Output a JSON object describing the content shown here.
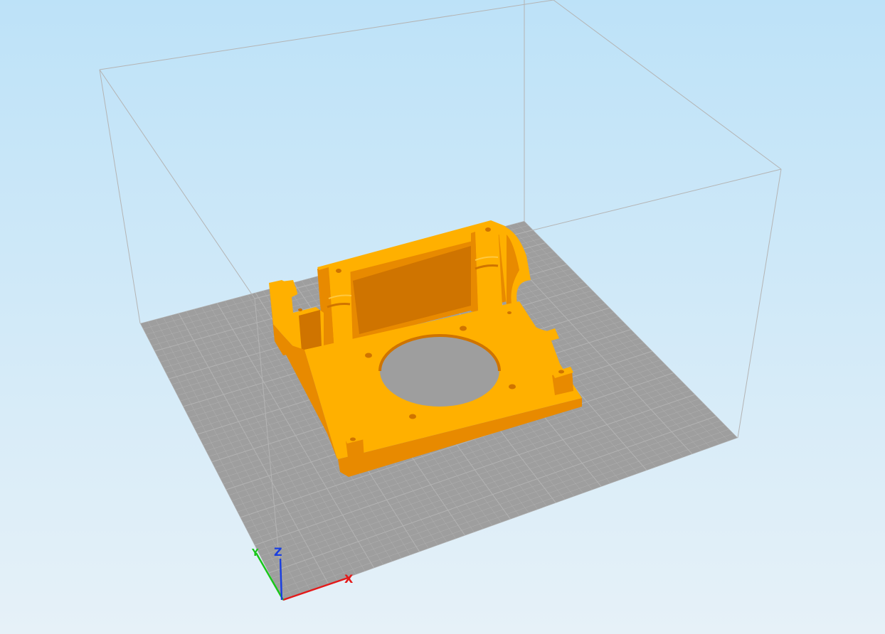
{
  "viewport": {
    "background_top": "#bde2f8",
    "background_bottom": "#e6f1f8"
  },
  "bed": {
    "color": "#9e9e9e",
    "grid_color": "#b3b3b3"
  },
  "build_volume": {
    "edge_color": "#b4b4b4"
  },
  "model": {
    "color_top": "#ffb000",
    "color_side": "#e88a00",
    "color_shadow": "#cf7400"
  },
  "axes": {
    "x_label": "X",
    "y_label": "Y",
    "z_label": "Z",
    "x_color": "#e31a1a",
    "y_color": "#19c619",
    "z_color": "#1a3fe0"
  }
}
